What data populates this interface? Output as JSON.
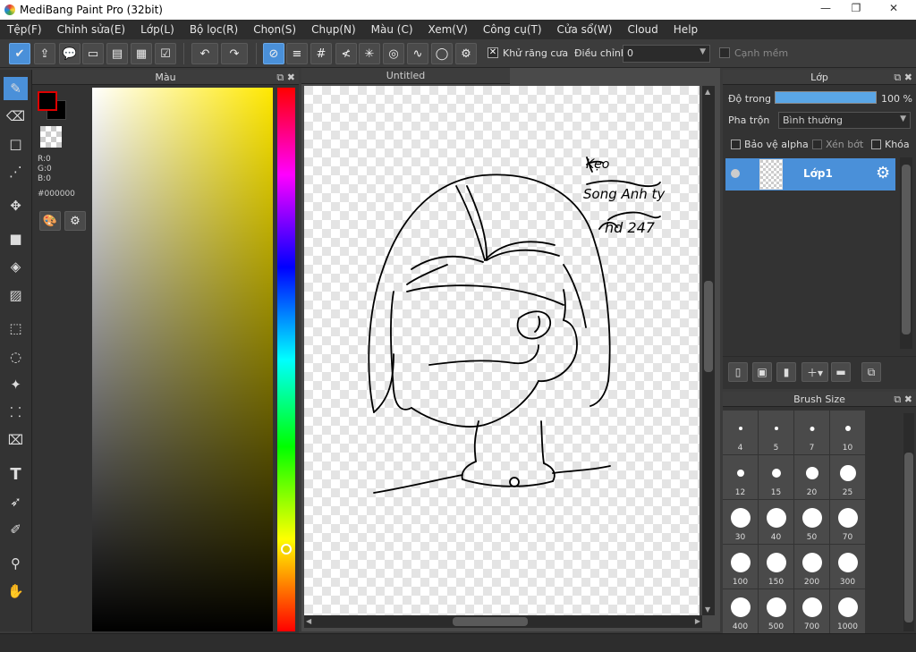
{
  "window": {
    "title": "MediBang Paint Pro (32bit)",
    "minimize": "—",
    "restore": "❐",
    "close": "✕"
  },
  "menu": [
    "Tệp(F)",
    "Chỉnh sửa(E)",
    "Lớp(L)",
    "Bộ lọc(R)",
    "Chọn(S)",
    "Chụp(N)",
    "Màu (C)",
    "Xem(V)",
    "Công cụ(T)",
    "Cửa sổ(W)",
    "Cloud",
    "Help"
  ],
  "toolbar": {
    "antialias_label": "Khử răng cưa",
    "antialias_check": "✕",
    "adjust_label": "Điều chỉnh",
    "adjust_value": "0",
    "soft_edge_label": "Cạnh mềm"
  },
  "color_panel": {
    "title": "Màu",
    "r": "R:0",
    "g": "G:0",
    "b": "B:0",
    "hex": "#000000",
    "colors": {
      "foreground": "#000000",
      "background": "#000000",
      "hue": "#ffe800"
    }
  },
  "document": {
    "tab": "Untitled",
    "handwriting": [
      "Kẹo",
      "Song Anh ty",
      "hd 247"
    ]
  },
  "layer_panel": {
    "title": "Lớp",
    "opacity_label": "Độ trong",
    "opacity_value": "100 %",
    "opacity_fraction": 1.0,
    "blend_label": "Pha trộn",
    "blend_value": "Bình thường",
    "protect_alpha": "Bảo vệ alpha",
    "clipping": "Xén bớt",
    "lock": "Khóa",
    "layers": [
      {
        "name": "Lớp1"
      }
    ]
  },
  "brush_panel": {
    "title": "Brush Size",
    "sizes": [
      "4",
      "5",
      "7",
      "10",
      "12",
      "15",
      "20",
      "25",
      "30",
      "40",
      "50",
      "70",
      "100",
      "150",
      "200",
      "300",
      "400",
      "500",
      "700",
      "1000"
    ]
  }
}
